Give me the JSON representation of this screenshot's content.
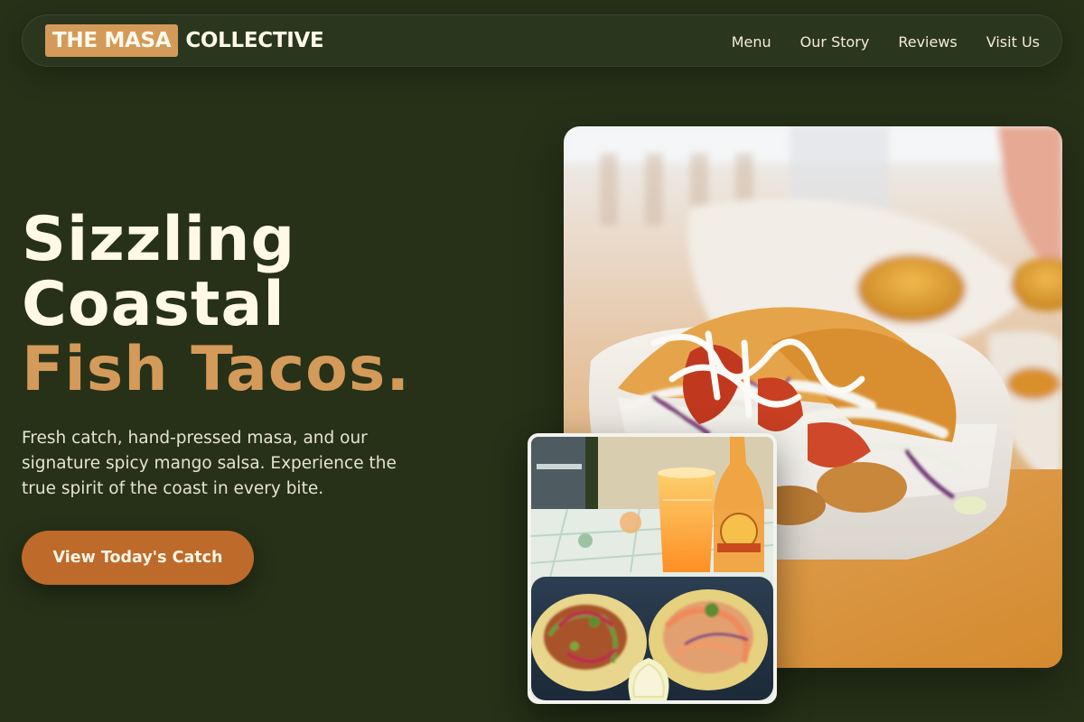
{
  "nav": {
    "logo_highlight": "THE MASA",
    "logo_rest": "COLLECTIVE",
    "links": [
      {
        "label": "Menu"
      },
      {
        "label": "Our Story"
      },
      {
        "label": "Reviews"
      },
      {
        "label": "Visit Us"
      }
    ]
  },
  "hero": {
    "headline_line1": "Sizzling",
    "headline_line2": "Coastal",
    "headline_line3": "Fish Tacos.",
    "description": "Fresh catch, hand-pressed masa, and our signature spicy mango salsa. Experience the true spirit of the coast in every bite.",
    "cta_label": "View Today's Catch"
  },
  "colors": {
    "background": "#263118",
    "accent": "#d49a5a",
    "cta": "#bd6a2a",
    "headline": "#fff9e6"
  }
}
